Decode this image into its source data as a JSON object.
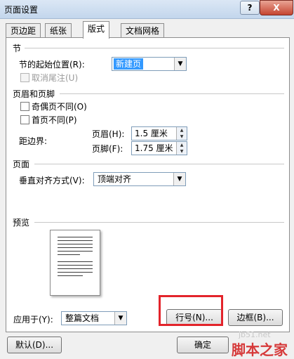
{
  "window": {
    "title": "页面设置",
    "help": "?",
    "close": "X"
  },
  "tabs": [
    "页边距",
    "纸张",
    "版式",
    "文档网格"
  ],
  "section": {
    "title": "节",
    "start_label": "节的起始位置(R):",
    "start_value": "新建页",
    "suppress_endnotes": "取消尾注(U)"
  },
  "header_footer": {
    "title": "页眉和页脚",
    "odd_even": "奇偶页不同(O)",
    "first_page": "首页不同(P)",
    "margin_label": "距边界:",
    "header_label": "页眉(H):",
    "header_value": "1.5 厘米",
    "footer_label": "页脚(F):",
    "footer_value": "1.75 厘米"
  },
  "page": {
    "title": "页面",
    "valign_label": "垂直对齐方式(V):",
    "valign_value": "顶端对齐"
  },
  "preview": {
    "title": "预览"
  },
  "apply": {
    "label": "应用于(Y):",
    "value": "整篇文档"
  },
  "buttons": {
    "line_numbers": "行号(N)...",
    "borders": "边框(B)...",
    "default": "默认(D)...",
    "ok": "确定"
  },
  "watermarks": {
    "site": "jb51.net",
    "brand": "脚本之家"
  }
}
